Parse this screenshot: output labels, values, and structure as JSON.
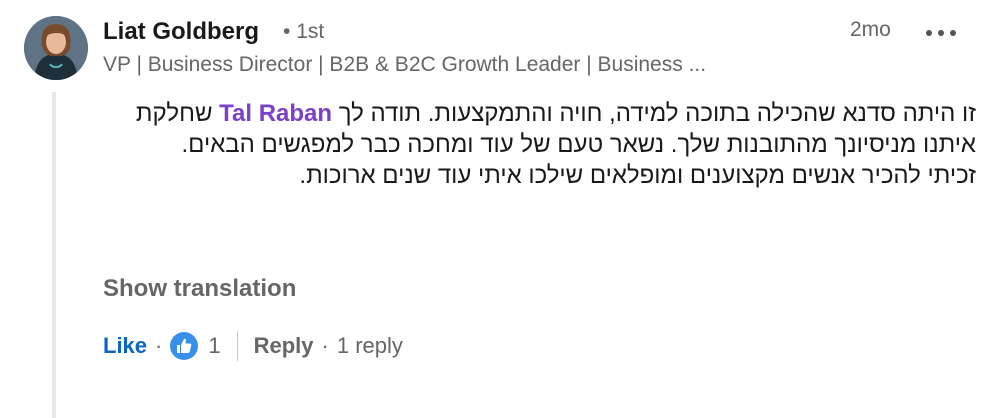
{
  "author": {
    "name": "Liat Goldberg",
    "degree": "1st",
    "degree_separator": "•",
    "headline": "VP | Business Director | B2B & B2C Growth Leader | Business ...",
    "time": "2mo"
  },
  "comment": {
    "mention": "Tal Raban",
    "before_mention": "זו היתה סדנא שהכילה בתוכה למידה, חויה והתמקצעות. תודה לך",
    "after_mention": "שחלקת איתנו מניסיונך מהתובנות שלך. נשאר טעם של עוד ומחכה כבר למפגשים הבאים.",
    "second_paragraph": "זכיתי להכיר אנשים מקצוענים ומופלאים שילכו איתי עוד שנים ארוכות."
  },
  "show_translation": "Show translation",
  "actions": {
    "like_label": "Like",
    "separator": "·",
    "reaction_count": "1",
    "reply_label": "Reply",
    "replies_count": "1 reply"
  },
  "icons": {
    "more": "more-horizontal-icon",
    "reaction": "like-thumb-icon"
  },
  "colors": {
    "mention": "#7c3fc7",
    "like": "#0a66c2",
    "reaction_badge": "#378fe9"
  }
}
